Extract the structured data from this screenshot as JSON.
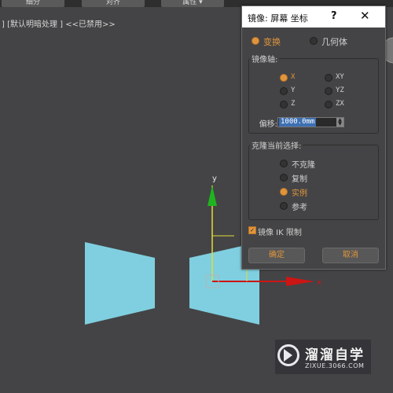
{
  "toolbar": {
    "subdivide_label": "细分",
    "align_label": "对齐",
    "properties_label": "属性 ▾"
  },
  "viewport": {
    "label": "] [默认明暗处理 ] <<已禁用>>",
    "y_axis_label": "y",
    "x_axis_label": "x",
    "shape_color": "#7fcfe0",
    "x_axis_color": "#cc1515",
    "y_axis_color": "#1fb41f"
  },
  "dialog": {
    "title": "镜像: 屏幕 坐标",
    "help_label": "?",
    "close_label": "✕",
    "mode": {
      "transform_label": "变换",
      "geometry_label": "几何体",
      "selected": "transform"
    },
    "mirror_axis": {
      "title": "镜像轴:",
      "options": [
        "X",
        "XY",
        "Y",
        "YZ",
        "Z",
        "ZX"
      ],
      "selected": "X",
      "offset_label": "偏移:",
      "offset_value": "1000.0mm"
    },
    "clone": {
      "title": "克隆当前选择:",
      "options": [
        "不克隆",
        "复制",
        "实例",
        "参考"
      ],
      "selected": "实例"
    },
    "mirror_ik_label": "镜像 IK 限制",
    "mirror_ik_checked": true,
    "ok_label": "确定",
    "cancel_label": "取消",
    "accent_color": "#e0953c"
  },
  "watermark": {
    "title": "溜溜自学",
    "url": "ZIXUE.3066.COM"
  }
}
